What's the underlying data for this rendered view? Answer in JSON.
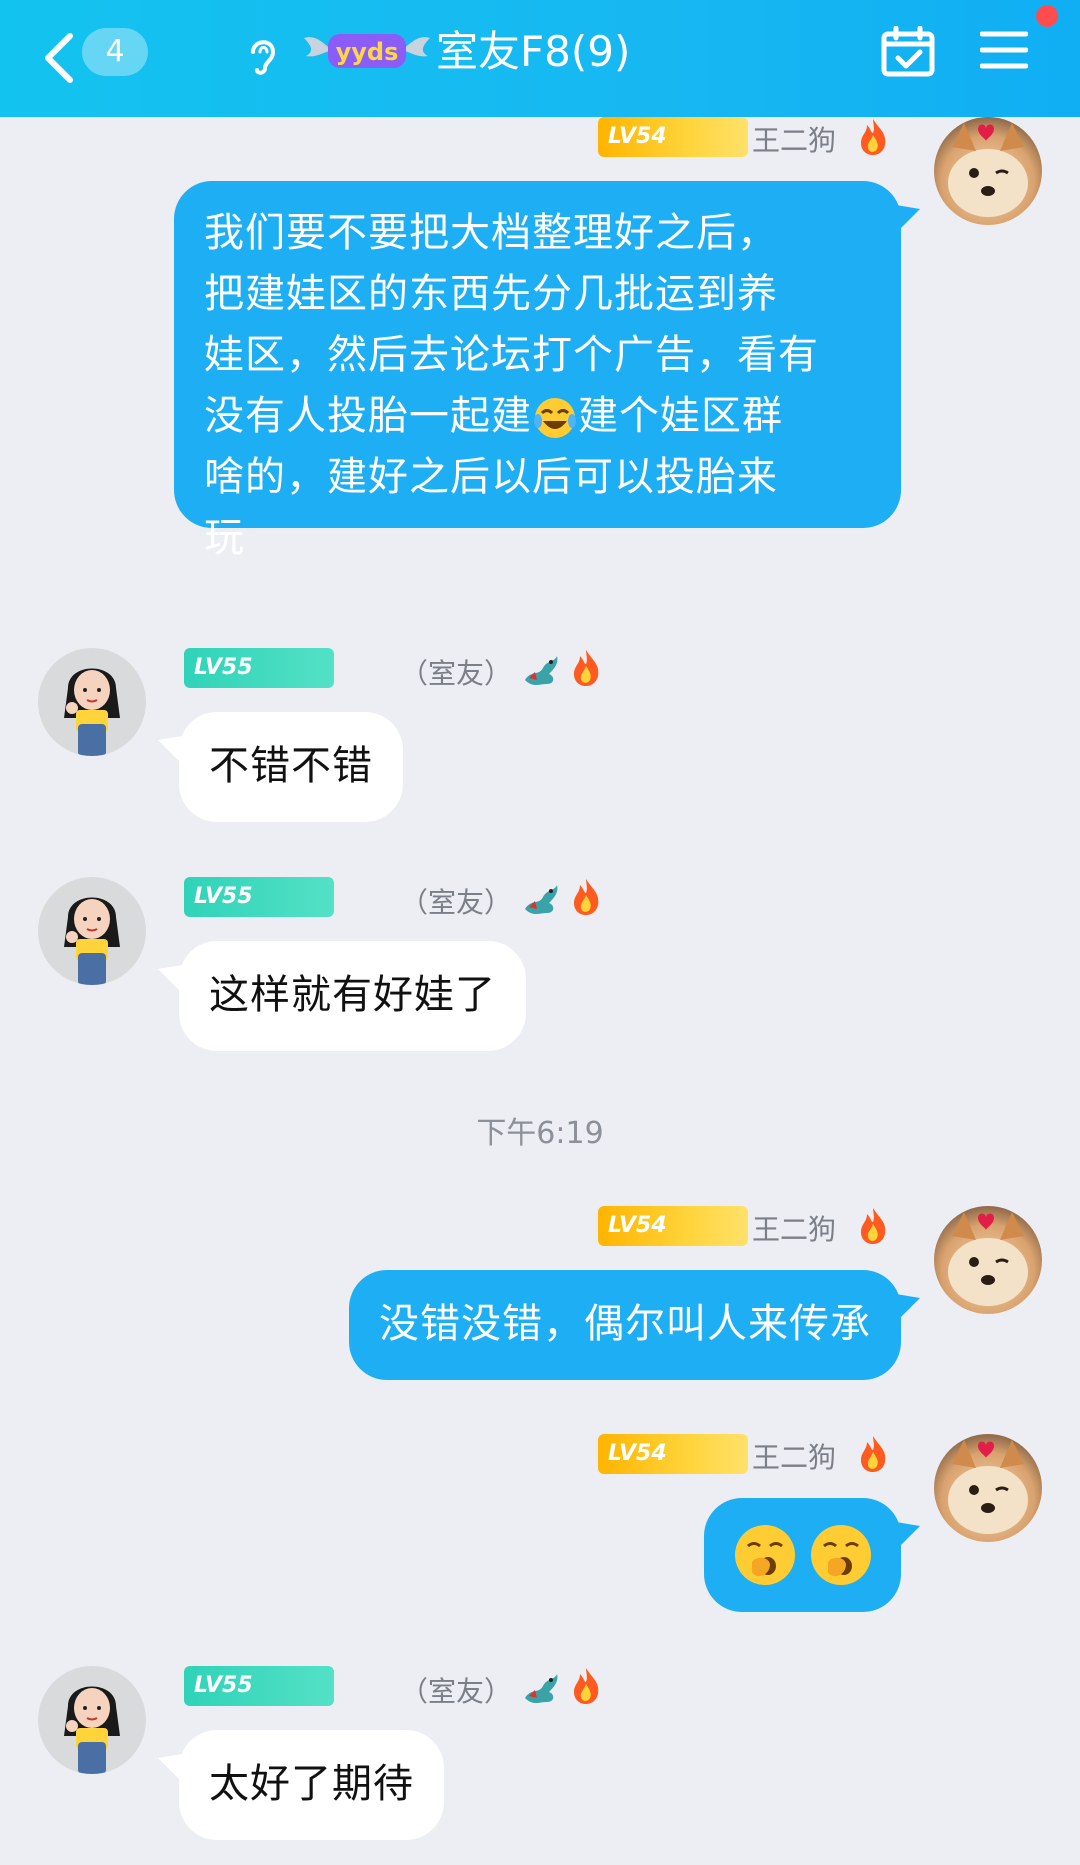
{
  "header": {
    "unread_count": "4",
    "badge_text": "yyds",
    "title": "室友F8(9)"
  },
  "messages": [
    {
      "side": "out",
      "level": "LV54",
      "sender": "王二狗",
      "text_parts": [
        "我们要不要把大档整理好之后，",
        "把建娃区的东西先分几批运到养",
        "娃区，然后去论坛打个广告，看有",
        "没有人投胎一起建",
        "建个娃区群",
        "啥的，建好之后以后可以投胎来",
        "玩"
      ],
      "inline_emoji": "tears-of-joy"
    },
    {
      "side": "in",
      "level": "LV55",
      "role": "（室友）",
      "text": "不错不错"
    },
    {
      "side": "in",
      "level": "LV55",
      "role": "（室友）",
      "text": "这样就有好娃了"
    },
    {
      "side": "out",
      "level": "LV54",
      "sender": "王二狗",
      "text": "没错没错，偶尔叫人来传承"
    },
    {
      "side": "out",
      "level": "LV54",
      "sender": "王二狗",
      "emoji": [
        "yawning-face-with-hand",
        "yawning-face-with-hand"
      ]
    },
    {
      "side": "in",
      "level": "LV55",
      "role": "（室友）",
      "text": "太好了期待"
    }
  ],
  "timestamp": "下午6:19",
  "colors": {
    "header_start": "#13c3ef",
    "header_end": "#10aef3",
    "outgoing_bubble": "#1eaef4",
    "incoming_bubble": "#ffffff",
    "background": "#eceef3",
    "level_gold": "#ffc21a",
    "level_teal": "#3dd9bd"
  }
}
